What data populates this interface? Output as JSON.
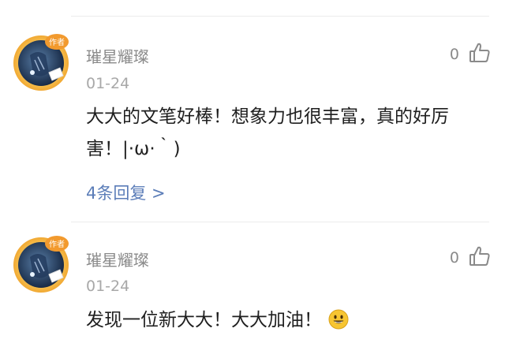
{
  "comments": [
    {
      "username": "璀星耀璨",
      "badge": "作者",
      "date": "01-24",
      "likes": "0",
      "text": "大大的文笔好棒！想象力也很丰富，真的好厉害！|·ω·｀)",
      "replies": "4条回复 >"
    },
    {
      "username": "璀星耀璨",
      "badge": "作者",
      "date": "01-24",
      "likes": "0",
      "text": "发现一位新大大！大大加油！",
      "emoji": "grinning-face-icon"
    }
  ],
  "colors": {
    "reply_link": "#5b7db8",
    "meta_text": "#8a8a8a",
    "body_text": "#1f1f1f",
    "badge": "#f29a2e"
  }
}
